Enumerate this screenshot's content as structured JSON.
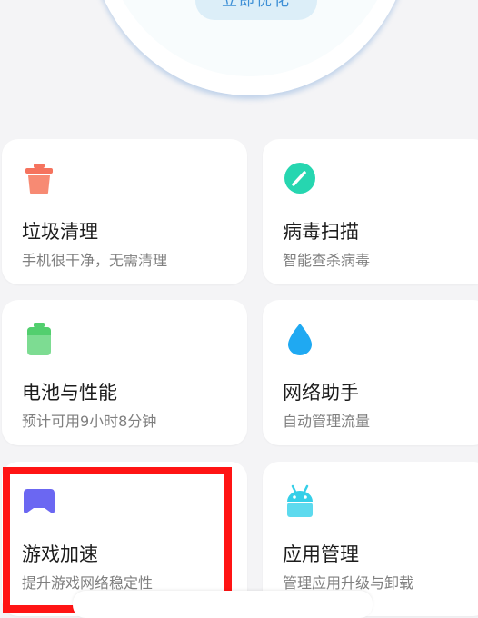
{
  "header": {
    "optimize_label": "立即优化",
    "ring_colors": {
      "outer": "#2f84d6",
      "mid": "#35b3ea",
      "inner": "#57d6ec"
    }
  },
  "cards": [
    {
      "title": "垃圾清理",
      "subtitle": "手机很干净，无需清理",
      "icon": "trash-icon",
      "color": "#f5735e"
    },
    {
      "title": "病毒扫描",
      "subtitle": "智能查杀病毒",
      "icon": "scan-gauge-icon",
      "color": "#26d6b0"
    },
    {
      "title": "电池与性能",
      "subtitle": "预计可用9小时8分钟",
      "icon": "battery-icon",
      "color": "#52cf6e"
    },
    {
      "title": "网络助手",
      "subtitle": "自动管理流量",
      "icon": "water-drop-icon",
      "color": "#1fa9f2"
    },
    {
      "title": "游戏加速",
      "subtitle": "提升游戏网络稳定性",
      "icon": "gamepad-icon",
      "color": "#6b67f2"
    },
    {
      "title": "应用管理",
      "subtitle": "管理应用升级与卸载",
      "icon": "android-icon",
      "color": "#35cfe8"
    }
  ],
  "highlight": {
    "target": "游戏加速",
    "color": "#ff1414"
  }
}
